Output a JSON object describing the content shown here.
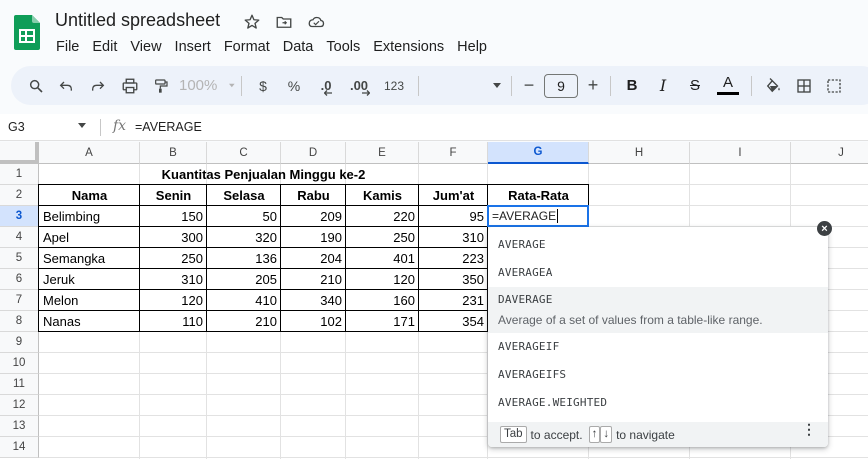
{
  "app": {
    "doc_title": "Untitled spreadsheet",
    "menu": [
      "File",
      "Edit",
      "View",
      "Insert",
      "Format",
      "Data",
      "Tools",
      "Extensions",
      "Help"
    ]
  },
  "toolbar": {
    "zoom": "100%",
    "currency": "$",
    "percent": "%",
    "dec_decrease": ".0",
    "dec_increase": ".00",
    "number_format": "123",
    "font_size": "9",
    "bold": "B",
    "italic": "I",
    "strike": "S",
    "text_color": "A",
    "minus": "−",
    "plus": "+"
  },
  "formula_bar": {
    "cell_ref": "G3",
    "fx": "fx",
    "formula": "=AVERAGE"
  },
  "grid": {
    "columns": [
      "A",
      "B",
      "C",
      "D",
      "E",
      "F",
      "G",
      "H",
      "I",
      "J"
    ],
    "selected_column": "G",
    "rows": [
      "1",
      "2",
      "3",
      "4",
      "5",
      "6",
      "7",
      "8",
      "9",
      "10",
      "11",
      "12",
      "13",
      "14"
    ],
    "selected_row": "3"
  },
  "sheet": {
    "title": "Kuantitas Penjualan Minggu ke-2",
    "headers": [
      "Nama",
      "Senin",
      "Selasa",
      "Rabu",
      "Kamis",
      "Jum'at",
      "Rata-Rata"
    ],
    "data_rows": [
      [
        "Belimbing",
        "150",
        "50",
        "209",
        "220",
        "95"
      ],
      [
        "Apel",
        "300",
        "320",
        "190",
        "250",
        "310"
      ],
      [
        "Semangka",
        "250",
        "136",
        "204",
        "401",
        "223"
      ],
      [
        "Jeruk",
        "310",
        "205",
        "210",
        "120",
        "350"
      ],
      [
        "Melon",
        "120",
        "410",
        "340",
        "160",
        "231"
      ],
      [
        "Nanas",
        "110",
        "210",
        "102",
        "171",
        "354"
      ]
    ],
    "active_cell_value": "=AVERAGE"
  },
  "autocomplete": {
    "suggestions": [
      {
        "name": "AVERAGE"
      },
      {
        "name": "AVERAGEA"
      },
      {
        "name": "DAVERAGE",
        "description": "Average of a set of values from a table-like range.",
        "highlighted": true
      },
      {
        "name": "AVERAGEIF"
      },
      {
        "name": "AVERAGEIFS"
      },
      {
        "name": "AVERAGE.WEIGHTED"
      }
    ],
    "footer": {
      "tab_key": "Tab",
      "accept_text": "to accept.",
      "up_key": "↑",
      "down_key": "↓",
      "navigate_text": "to navigate"
    },
    "close_label": "×",
    "more_label": "⋮"
  },
  "colors": {
    "accent": "#1a73e8",
    "selected_header_bg": "#d3e3fd",
    "toolbar_bg": "#edf2fa",
    "sheets_green": "#0f9d58"
  }
}
